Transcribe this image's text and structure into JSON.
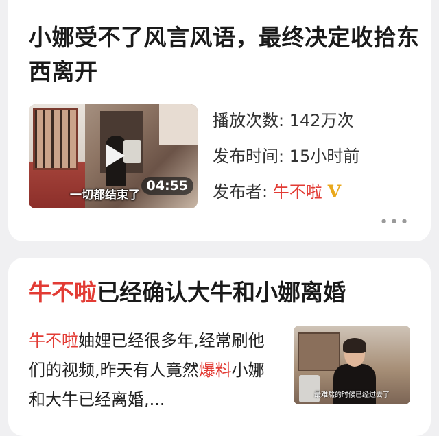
{
  "card1": {
    "title": "小娜受不了风言风语，最终决定收拾东西离开",
    "thumbnail": {
      "subtitle": "一切都结束了",
      "duration": "04:55"
    },
    "play_count_label": "播放次数: ",
    "play_count_value": "142万次",
    "publish_time_label": "发布时间: ",
    "publish_time_value": "15小时前",
    "publisher_label": "发布者: ",
    "publisher_name": "牛不啦",
    "verified_badge": "V",
    "more_label": "•••"
  },
  "card2": {
    "title_highlight": "牛不啦",
    "title_rest": "已经确认大牛和小娜离婚",
    "body_highlight1": "牛不啦",
    "body_part1": "妯娌已经很多年,经常刷他们的视频,昨天有人竟然",
    "body_highlight2": "爆料",
    "body_part2": "小娜和大牛已经离婚,...",
    "thumbnail_caption": "最难熬的时候已经过去了"
  },
  "colors": {
    "background": "#f0f0f2",
    "card": "#ffffff",
    "highlight_red": "#e23b34",
    "badge_gold": "#e9a81c"
  },
  "icons": [
    "play-icon",
    "verified-v-icon",
    "more-dots-icon"
  ]
}
